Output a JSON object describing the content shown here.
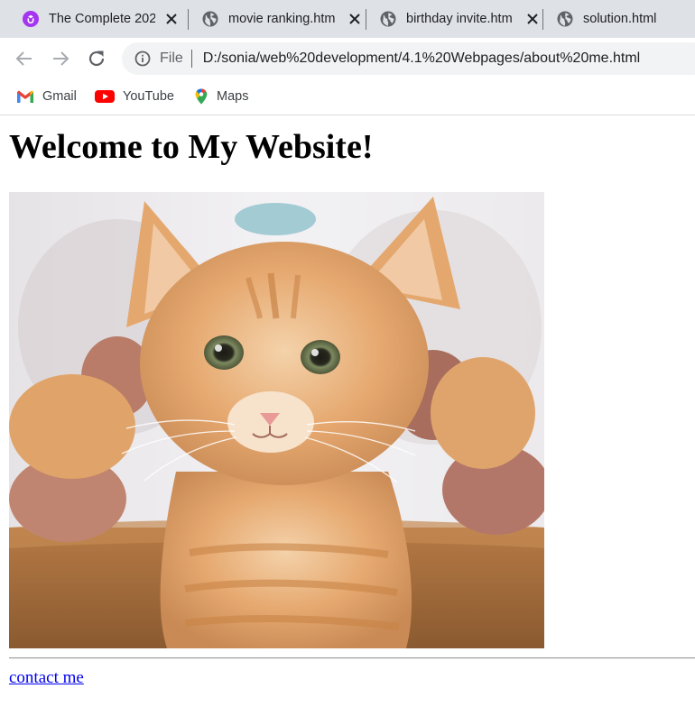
{
  "browser": {
    "tabs": [
      {
        "title": "The Complete 202",
        "icon": "udemy-icon",
        "closable": true
      },
      {
        "title": "movie ranking.htm",
        "icon": "globe-icon",
        "closable": true
      },
      {
        "title": "birthday invite.htm",
        "icon": "globe-icon",
        "closable": true
      },
      {
        "title": "solution.html",
        "icon": "globe-icon",
        "closable": false
      }
    ],
    "address_bar": {
      "scheme_label": "File",
      "url": "D:/sonia/web%20development/4.1%20Webpages/about%20me.html"
    },
    "bookmarks": [
      {
        "label": "Gmail",
        "icon": "gmail-icon"
      },
      {
        "label": "YouTube",
        "icon": "youtube-icon"
      },
      {
        "label": "Maps",
        "icon": "maps-icon"
      }
    ]
  },
  "page": {
    "heading": "Welcome to My Website!",
    "image_subject": "kitten-photo",
    "contact_link": "contact me"
  },
  "colors": {
    "tab_strip": "#dee1e6",
    "omnibox": "#f1f3f4",
    "link": "#0000ee",
    "udemy_purple": "#a435f0"
  }
}
